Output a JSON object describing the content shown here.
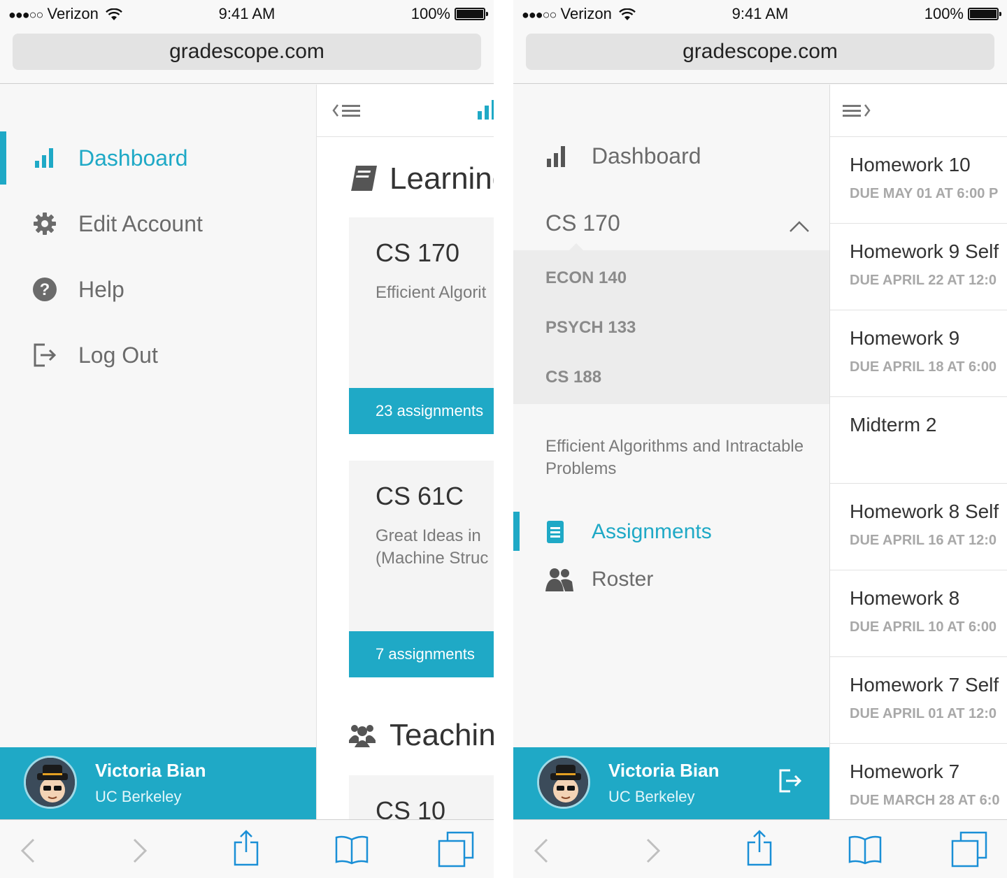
{
  "status_bar": {
    "signal": "●●●○○",
    "carrier": "Verizon",
    "time": "9:41 AM",
    "battery": "100%"
  },
  "browser": {
    "url": "gradescope.com"
  },
  "left_screen": {
    "nav": [
      {
        "label": "Dashboard",
        "icon": "bar-chart-icon",
        "active": true
      },
      {
        "label": "Edit Account",
        "icon": "gear-icon",
        "active": false
      },
      {
        "label": "Help",
        "icon": "question-circle-icon",
        "active": false
      },
      {
        "label": "Log Out",
        "icon": "logout-icon",
        "active": false
      }
    ],
    "sections": {
      "learning": "Learning",
      "teaching": "Teachin"
    },
    "courses": [
      {
        "name": "CS 170",
        "description": "Efficient Algorit",
        "assignments": "23 assignments"
      },
      {
        "name": "CS 61C",
        "description": "Great Ideas in \n(Machine Struc",
        "assignments": "7 assignments"
      },
      {
        "name": "CS 10"
      }
    ]
  },
  "right_screen": {
    "dashboard_label": "Dashboard",
    "current_course": "CS 170",
    "course_options": [
      "ECON 140",
      "PSYCH 133",
      "CS 188"
    ],
    "course_title": "Efficient Algorithms and Intractable Problems",
    "menu": [
      {
        "label": "Assignments",
        "icon": "document-icon",
        "active": true
      },
      {
        "label": "Roster",
        "icon": "users-icon",
        "active": false
      }
    ],
    "assignments": [
      {
        "name": "Homework 10",
        "due": "DUE MAY 01 AT 6:00 P"
      },
      {
        "name": "Homework 9 Self",
        "due": "DUE APRIL 22 AT 12:0"
      },
      {
        "name": "Homework 9",
        "due": "DUE APRIL 18 AT 6:00"
      },
      {
        "name": "Midterm 2",
        "due": ""
      },
      {
        "name": "Homework 8 Self",
        "due": "DUE APRIL 16 AT 12:0"
      },
      {
        "name": "Homework 8",
        "due": "DUE APRIL 10 AT 6:00"
      },
      {
        "name": "Homework 7 Self",
        "due": "DUE APRIL 01 AT 12:0"
      },
      {
        "name": "Homework 7",
        "due": "DUE MARCH 28 AT 6:0"
      }
    ]
  },
  "user": {
    "name": "Victoria Bian",
    "school": "UC Berkeley"
  },
  "colors": {
    "accent": "#1fa9c6",
    "drawer_bg": "#f7f7f7",
    "text": "#6b6b6b"
  }
}
